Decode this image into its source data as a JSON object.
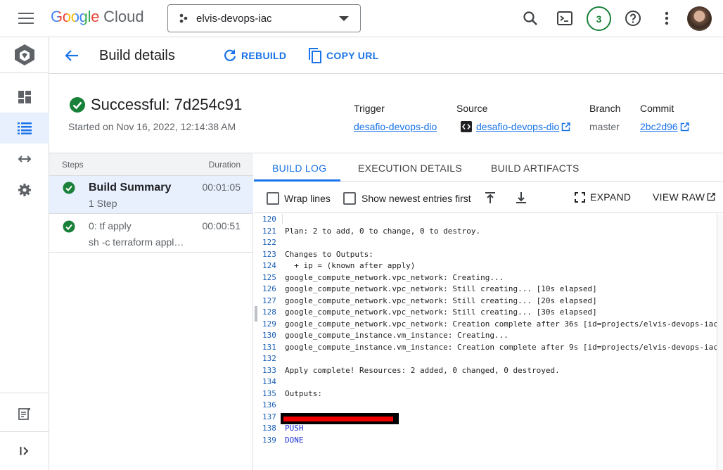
{
  "header": {
    "logo_google": "Google",
    "logo_cloud": "Cloud",
    "project_name": "elvis-devops-iac",
    "notification_count": "3"
  },
  "page": {
    "title": "Build details",
    "rebuild_label": "REBUILD",
    "copy_url_label": "COPY URL"
  },
  "build": {
    "status_title": "Successful: 7d254c91",
    "started": "Started on Nov 16, 2022, 12:14:38 AM",
    "trigger_label": "Trigger",
    "trigger_value": "desafio-devops-dio",
    "source_label": "Source",
    "source_value": "desafio-devops-dio",
    "branch_label": "Branch",
    "branch_value": "master",
    "commit_label": "Commit",
    "commit_value": "2bc2d96"
  },
  "steps": {
    "header_steps": "Steps",
    "header_duration": "Duration",
    "items": [
      {
        "name": "Build Summary",
        "sub": "1 Step",
        "duration": "00:01:05"
      },
      {
        "name": "0: tf apply",
        "sub": "sh -c terraform appl…",
        "duration": "00:00:51"
      }
    ]
  },
  "tabs": {
    "build_log": "BUILD LOG",
    "execution_details": "EXECUTION DETAILS",
    "build_artifacts": "BUILD ARTIFACTS"
  },
  "log_toolbar": {
    "wrap_lines": "Wrap lines",
    "show_newest": "Show newest entries first",
    "expand": "EXPAND",
    "view_raw": "VIEW RAW"
  },
  "log": {
    "lines": [
      {
        "n": "120",
        "t": ""
      },
      {
        "n": "121",
        "t": "Plan: 2 to add, 0 to change, 0 to destroy."
      },
      {
        "n": "122",
        "t": ""
      },
      {
        "n": "123",
        "t": "Changes to Outputs:"
      },
      {
        "n": "124",
        "t": "  + ip = (known after apply)"
      },
      {
        "n": "125",
        "t": "google_compute_network.vpc_network: Creating..."
      },
      {
        "n": "126",
        "t": "google_compute_network.vpc_network: Still creating... [10s elapsed]"
      },
      {
        "n": "127",
        "t": "google_compute_network.vpc_network: Still creating... [20s elapsed]"
      },
      {
        "n": "128",
        "t": "google_compute_network.vpc_network: Still creating... [30s elapsed]"
      },
      {
        "n": "129",
        "t": "google_compute_network.vpc_network: Creation complete after 36s [id=projects/elvis-devops-iac/"
      },
      {
        "n": "130",
        "t": "google_compute_instance.vm_instance: Creating..."
      },
      {
        "n": "131",
        "t": "google_compute_instance.vm_instance: Creation complete after 9s [id=projects/elvis-devops-iac/"
      },
      {
        "n": "132",
        "t": ""
      },
      {
        "n": "133",
        "t": "Apply complete! Resources: 2 added, 0 changed, 0 destroyed."
      },
      {
        "n": "134",
        "t": ""
      },
      {
        "n": "135",
        "t": "Outputs:"
      },
      {
        "n": "136",
        "t": ""
      },
      {
        "n": "137",
        "t": ""
      },
      {
        "n": "138",
        "t": "PUSH"
      },
      {
        "n": "139",
        "t": "DONE"
      }
    ]
  },
  "colors": {
    "accent": "#1a73e8",
    "success": "#188038",
    "redaction": "#e00000"
  }
}
